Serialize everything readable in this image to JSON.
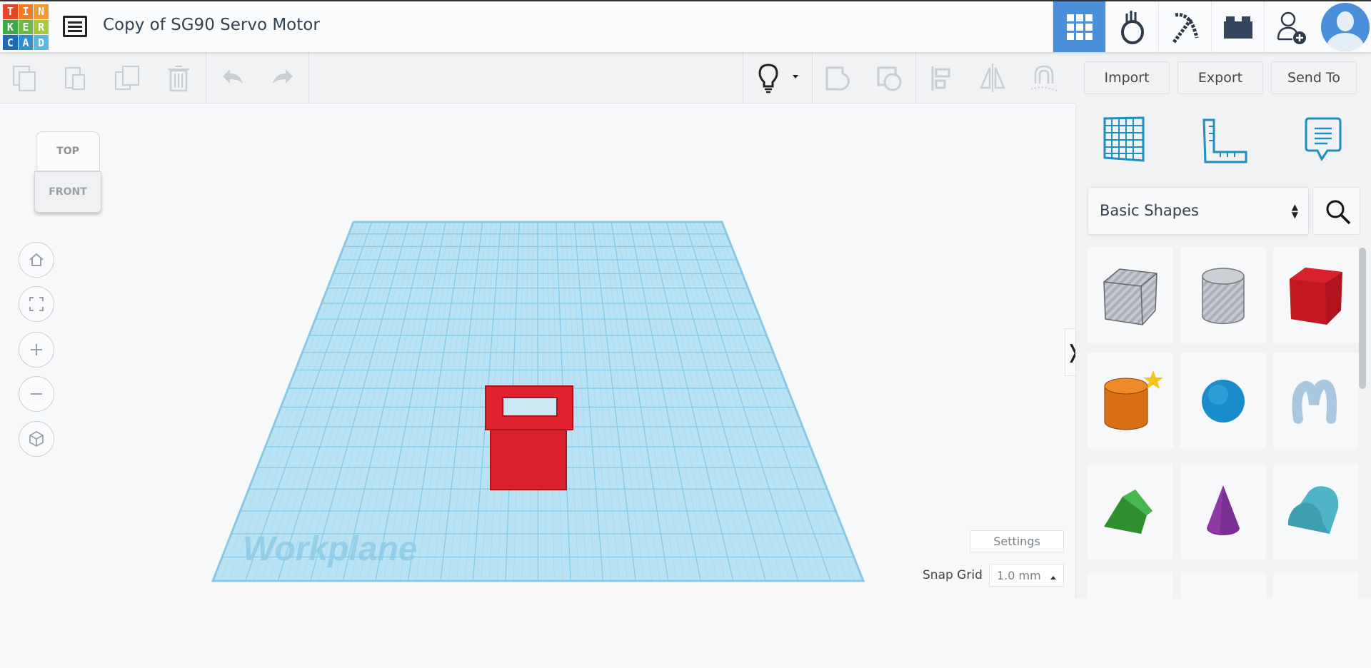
{
  "header": {
    "logo_letters": [
      "T",
      "I",
      "N",
      "K",
      "E",
      "R",
      "C",
      "A",
      "D"
    ],
    "logo_colors": [
      "#e2462b",
      "#f07c27",
      "#f29a2d",
      "#40a84a",
      "#6cba45",
      "#a6c93c",
      "#1d6bb3",
      "#2e8fd0",
      "#5ab8e5"
    ],
    "title": "Copy of SG90 Servo Motor"
  },
  "topnav": [
    "3d-design-grid",
    "codeblocks-hand",
    "minecraft-pickaxe",
    "lego-brick",
    "invite-user",
    "user-avatar"
  ],
  "toolbar": {
    "import": "Import",
    "export": "Export",
    "send_to": "Send To"
  },
  "viewcube": {
    "top": "TOP",
    "front": "FRONT"
  },
  "workplane": {
    "label": "Workplane",
    "grid_color": "#7fc8e6",
    "object_color": "#d9202c"
  },
  "settings": {
    "label": "Settings",
    "snap_label": "Snap Grid",
    "snap_value": "1.0 mm"
  },
  "panel": {
    "category": "Basic Shapes",
    "shapes": [
      "Box Hole",
      "Cylinder Hole",
      "Box",
      "Cylinder",
      "Sphere",
      "Scribble",
      "Roof",
      "Cone",
      "Round Roof"
    ]
  },
  "accent": "#4a8fd9"
}
